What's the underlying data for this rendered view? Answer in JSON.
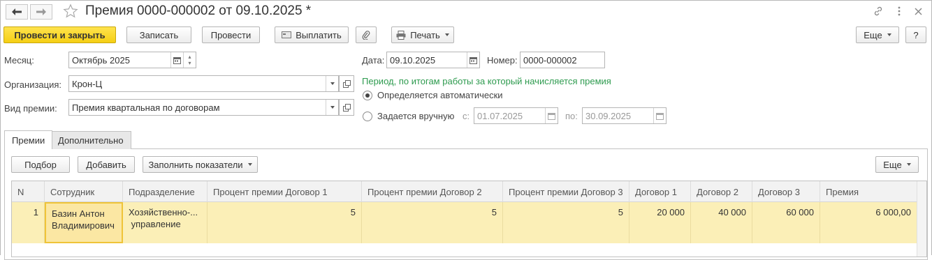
{
  "window": {
    "title": "Премия 0000-000002 от 09.10.2025 *"
  },
  "icons": {
    "back": "arrow-left-icon",
    "forward": "arrow-right-icon",
    "favorite": "star-icon",
    "link": "link-icon",
    "more": "vertical-dots-icon",
    "close": "close-icon",
    "attach": "paperclip-icon",
    "print": "printer-icon",
    "pay": "pay-icon",
    "calendar": "calendar-icon",
    "open": "open-form-icon"
  },
  "toolbar": {
    "post_close": "Провести и закрыть",
    "save": "Записать",
    "post": "Провести",
    "pay": "Выплатить",
    "print": "Печать",
    "more": "Еще",
    "help": "?"
  },
  "form": {
    "month_label": "Месяц:",
    "month_value": "Октябрь 2025",
    "org_label": "Организация:",
    "org_value": "Крон-Ц",
    "type_label": "Вид премии:",
    "type_value": "Премия квартальная по договорам",
    "date_label": "Дата:",
    "date_value": "09.10.2025",
    "number_label": "Номер:",
    "number_value": "0000-000002",
    "period_caption": "Период, по итогам работы за который начисляется премия",
    "radio_auto": "Определяется автоматически",
    "radio_manual": "Задается вручную",
    "from_label": "с:",
    "from_value": "01.07.2025",
    "to_label": "по:",
    "to_value": "30.09.2025",
    "selected_period_mode": "auto"
  },
  "tabs": [
    {
      "label": "Премии",
      "active": true
    },
    {
      "label": "Дополнительно",
      "active": false
    }
  ],
  "table_toolbar": {
    "pick": "Подбор",
    "add": "Добавить",
    "fill": "Заполнить показатели",
    "more": "Еще"
  },
  "table": {
    "columns": [
      "N",
      "Сотрудник",
      "Подразделение",
      "Процент премии Договор 1",
      "Процент премии Договор 2",
      "Процент премии Договор 3",
      "Договор 1",
      "Договор 2",
      "Договор 3",
      "Премия"
    ],
    "rows": [
      {
        "n": "1",
        "employee_line1": "Базин Антон",
        "employee_line2": "Владимирович",
        "dept_line1": "Хозяйственно-...",
        "dept_line2": " управление",
        "pct1": "5",
        "pct2": "5",
        "pct3": "5",
        "c1": "20 000",
        "c2": "40 000",
        "c3": "60 000",
        "bonus": "6 000,00"
      }
    ]
  },
  "colors": {
    "primary_button": "#f5cf14",
    "selected_row": "#fbefb7",
    "caption_green": "#2e9b4f"
  }
}
